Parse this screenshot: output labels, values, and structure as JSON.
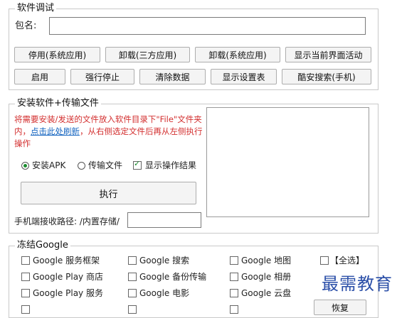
{
  "debug": {
    "title": "软件调试",
    "package_label": "包名:",
    "package_value": "",
    "row1": [
      "停用(系统应用)",
      "卸载(三方应用)",
      "卸载(系统应用)",
      "显示当前界面活动"
    ],
    "row2": [
      "启用",
      "强行停止",
      "清除数据",
      "显示设置表",
      "酷安搜索(手机)"
    ]
  },
  "install": {
    "title": "安装软件+传输文件",
    "note_part1": "将需要安装/发送的文件放入软件目录下\"File\"文件夹内，",
    "note_link": "点击此处刷新",
    "note_part2": "，从右侧选定文件后再从左侧执行操作",
    "radio_apk": "安装APK",
    "radio_transfer": "传输文件",
    "check_show_result": "显示操作结果",
    "execute": "执行",
    "path_label": "手机端接收路径: /内置存储/",
    "path_value": ""
  },
  "freeze": {
    "title": "冻结Google",
    "col1": [
      "Google 服务框架",
      "Google Play 商店",
      "Google Play 服务"
    ],
    "col2": [
      "Google 搜索",
      "Google 备份传输",
      "Google 电影"
    ],
    "col3": [
      "Google 地图",
      "Google 相册",
      "Google 云盘"
    ],
    "select_all": "【全选】",
    "restore": "恢复"
  },
  "watermark": "最需教育"
}
